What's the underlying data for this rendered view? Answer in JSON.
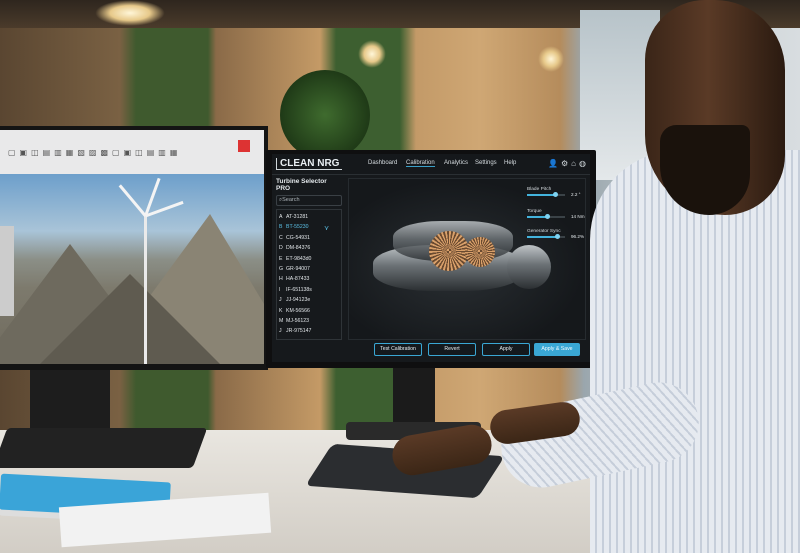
{
  "app": {
    "logo": "CLEAN NRG",
    "nav": [
      "Dashboard",
      "Calibration",
      "Analytics",
      "Settings",
      "Help"
    ],
    "active_nav": "Calibration",
    "accent": "#3aa7d4"
  },
  "sidebar": {
    "title": "Turbine Selector PRO",
    "search_placeholder": "Search",
    "items": [
      {
        "letter": "A",
        "id": "AT-31281"
      },
      {
        "letter": "B",
        "id": "BT-55230"
      },
      {
        "letter": "C",
        "id": "CG-54931"
      },
      {
        "letter": "D",
        "id": "DM-84376"
      },
      {
        "letter": "E",
        "id": "ET-9843d0"
      },
      {
        "letter": "G",
        "id": "GR-94007"
      },
      {
        "letter": "H",
        "id": "HA-87433"
      },
      {
        "letter": "I",
        "id": "IF-651138s"
      },
      {
        "letter": "J",
        "id": "JJ-94123e"
      },
      {
        "letter": "K",
        "id": "KM-56566"
      },
      {
        "letter": "M",
        "id": "MJ-56123"
      },
      {
        "letter": "J",
        "id": "JR-975147"
      }
    ],
    "selected_index": 1
  },
  "controls": [
    {
      "label": "Blade Pitch",
      "value": "2.2 °",
      "level": 0.75
    },
    {
      "label": "Torque",
      "value": "14 Nm",
      "level": 0.55
    },
    {
      "label": "Generator Sync",
      "value": "96.2%",
      "level": 0.8
    }
  ],
  "buttons": {
    "test": "Test Calibration",
    "revert": "Revert",
    "apply": "Apply",
    "apply_save": "Apply & Save"
  },
  "icons": {
    "user": "user-icon",
    "settings": "gear-icon",
    "home": "home-icon",
    "globe": "globe-icon",
    "search": "search-icon",
    "turbine": "wind-turbine-icon"
  }
}
